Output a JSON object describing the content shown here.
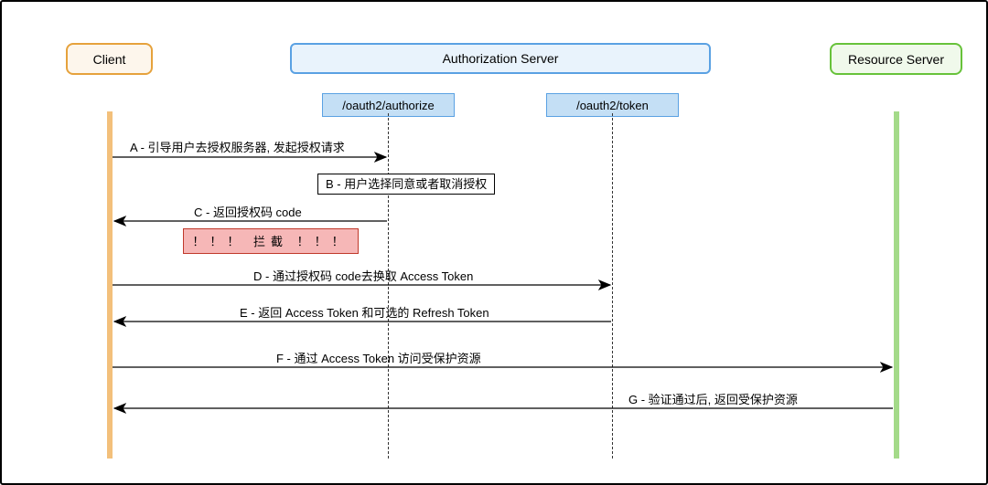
{
  "participants": {
    "client": "Client",
    "auth_server": "Authorization Server",
    "endpoints": {
      "authorize": "/oauth2/authorize",
      "token": "/oauth2/token"
    },
    "resource": "Resource Server"
  },
  "messages": {
    "a": "A - 引导用户去授权服务器, 发起授权请求",
    "b": "B - 用户选择同意或者取消授权",
    "c": "C - 返回授权码 code",
    "intercept": "！！！   拦截   ！！！",
    "d": "D - 通过授权码 code去换取 Access Token",
    "e": "E - 返回 Access Token 和可选的 Refresh Token",
    "f": "F - 通过 Access Token 访问受保护资源",
    "g": "G - 验证通过后, 返回受保护资源"
  },
  "chart_data": {
    "type": "sequence-diagram",
    "participants": [
      "Client",
      "Authorization Server (/oauth2/authorize)",
      "Authorization Server (/oauth2/token)",
      "Resource Server"
    ],
    "steps": [
      {
        "from": "Client",
        "to": "/oauth2/authorize",
        "label": "A - 引导用户去授权服务器, 发起授权请求"
      },
      {
        "self": "/oauth2/authorize",
        "label": "B - 用户选择同意或者取消授权"
      },
      {
        "from": "/oauth2/authorize",
        "to": "Client",
        "label": "C - 返回授权码 code",
        "note": "！！！ 拦截 ！！！"
      },
      {
        "from": "Client",
        "to": "/oauth2/token",
        "label": "D - 通过授权码 code去换取 Access Token"
      },
      {
        "from": "/oauth2/token",
        "to": "Client",
        "label": "E - 返回 Access Token 和可选的 Refresh Token"
      },
      {
        "from": "Client",
        "to": "Resource Server",
        "label": "F - 通过 Access Token 访问受保护资源"
      },
      {
        "from": "Resource Server",
        "to": "Client",
        "label": "G - 验证通过后, 返回受保护资源"
      }
    ]
  }
}
